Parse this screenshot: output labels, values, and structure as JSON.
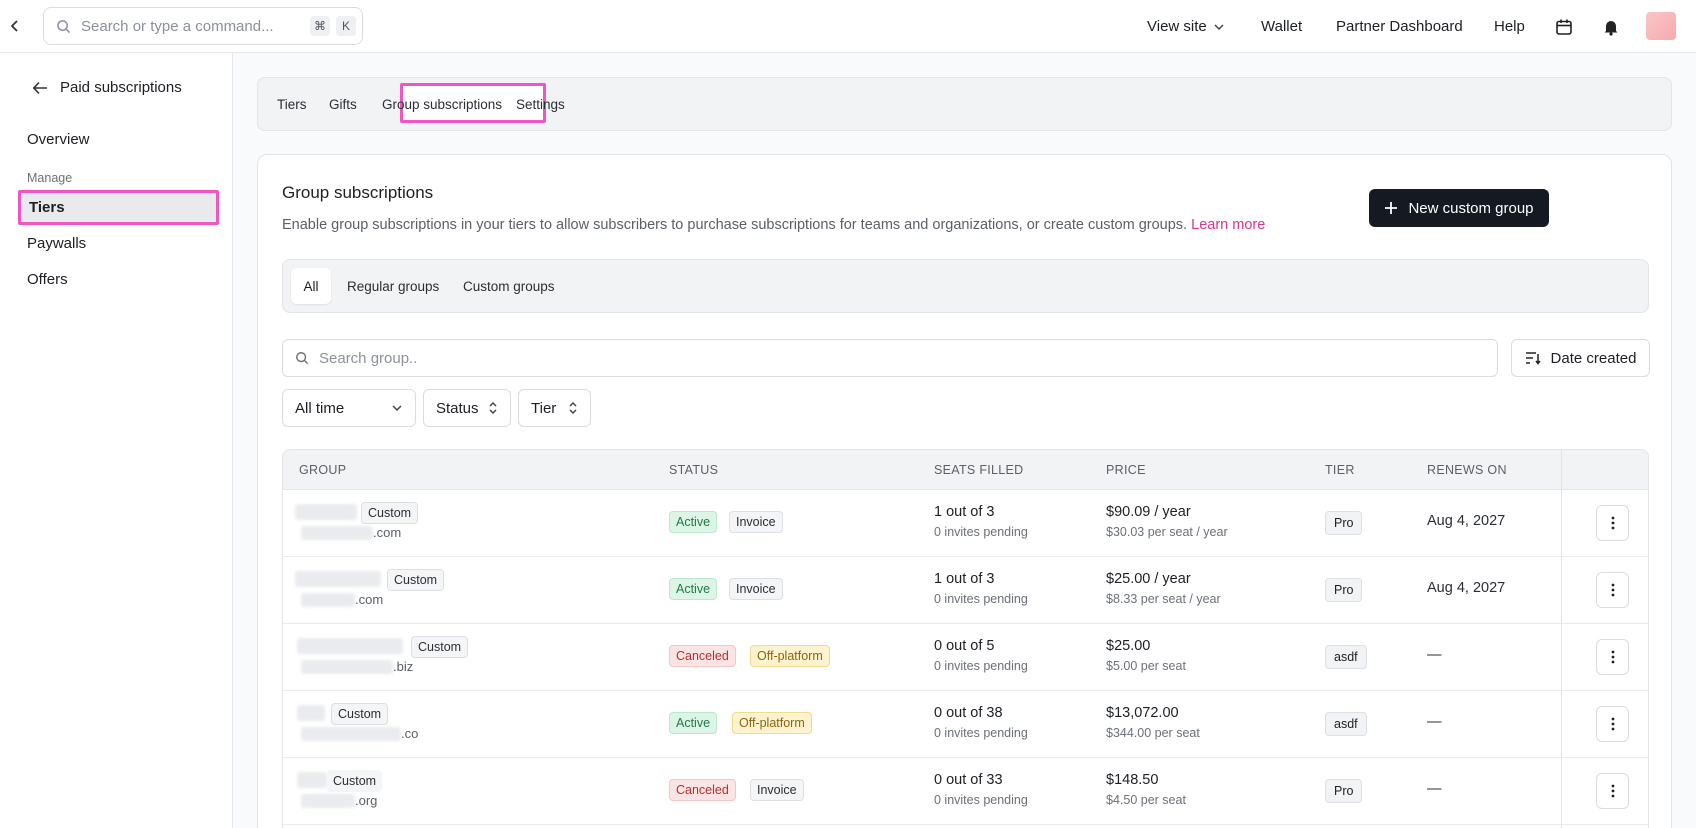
{
  "topbar": {
    "search_placeholder": "Search or type a command...",
    "kbd_cmd": "⌘",
    "kbd_k": "K",
    "view_site": "View site",
    "wallet": "Wallet",
    "partner_dashboard": "Partner Dashboard",
    "help": "Help"
  },
  "sidebar": {
    "back_label": "Paid subscriptions",
    "overview": "Overview",
    "section_manage": "Manage",
    "tiers": "Tiers",
    "paywalls": "Paywalls",
    "offers": "Offers"
  },
  "tabs": [
    "Tiers",
    "Gifts",
    "Group subscriptions",
    "Settings"
  ],
  "card": {
    "title": "Group subscriptions",
    "description": "Enable group subscriptions in your tiers to allow subscribers to purchase subscriptions for teams and organizations, or create custom groups.",
    "learn_more": "Learn more",
    "new_button": "New custom group"
  },
  "segments": [
    "All",
    "Regular groups",
    "Custom groups"
  ],
  "search": {
    "placeholder": "Search group.."
  },
  "sort": {
    "label": "Date created"
  },
  "filters": {
    "time": "All time",
    "status": "Status",
    "tier": "Tier"
  },
  "table": {
    "headers": [
      "GROUP",
      "STATUS",
      "SEATS FILLED",
      "PRICE",
      "TIER",
      "RENEWS ON"
    ],
    "rows": [
      {
        "group_tag": "Custom",
        "domain": ".com",
        "status": "Active",
        "billing": "Invoice",
        "seats": "1 out of 3",
        "pending": "0 invites pending",
        "price": "$90.09 / year",
        "price_sub": "$30.03 per seat / year",
        "tier": "Pro",
        "renews": "Aug 4, 2027"
      },
      {
        "group_tag": "Custom",
        "domain": ".com",
        "status": "Active",
        "billing": "Invoice",
        "seats": "1 out of 3",
        "pending": "0 invites pending",
        "price": "$25.00 / year",
        "price_sub": "$8.33 per seat / year",
        "tier": "Pro",
        "renews": "Aug 4, 2027"
      },
      {
        "group_tag": "Custom",
        "domain": ".biz",
        "status": "Canceled",
        "billing": "Off-platform",
        "seats": "0 out of 5",
        "pending": "0 invites pending",
        "price": "$25.00",
        "price_sub": "$5.00 per seat",
        "tier": "asdf",
        "renews": "—"
      },
      {
        "group_tag": "Custom",
        "domain": ".co",
        "status": "Active",
        "billing": "Off-platform",
        "seats": "0 out of 38",
        "pending": "0 invites pending",
        "price": "$13,072.00",
        "price_sub": "$344.00 per seat",
        "tier": "asdf",
        "renews": "—"
      },
      {
        "group_tag": "Custom",
        "domain": ".org",
        "status": "Canceled",
        "billing": "Invoice",
        "seats": "0 out of 33",
        "pending": "0 invites pending",
        "price": "$148.50",
        "price_sub": "$4.50 per seat",
        "tier": "Pro",
        "renews": "—"
      }
    ]
  },
  "colors": {
    "highlight": "#f055c0",
    "link": "#d9348f",
    "primary_button": "#141922"
  }
}
